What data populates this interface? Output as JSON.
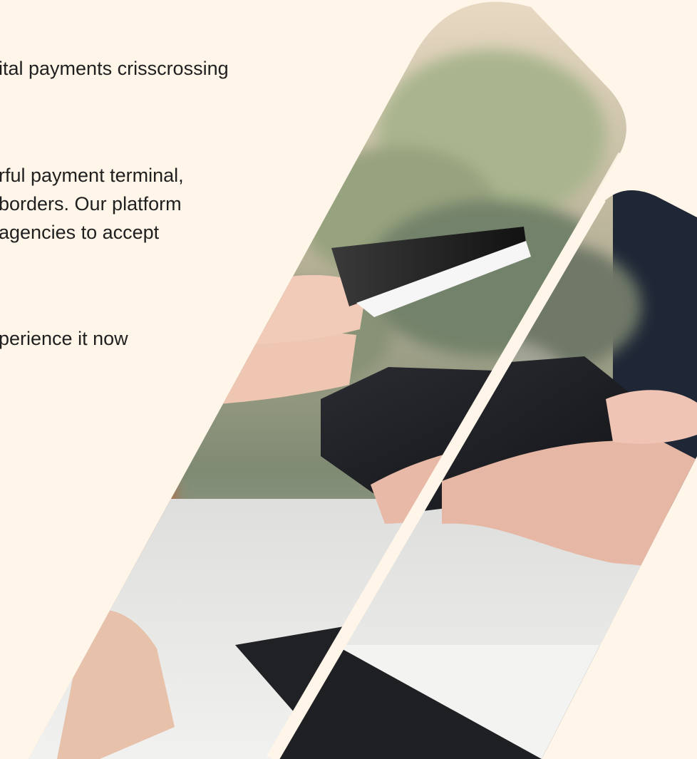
{
  "intro": {
    "line1": "ital payments crisscrossing",
    "line2": "rful payment terminal,",
    "line3": "borders. Our platform",
    "line4": "agencies to accept",
    "line5": "perience it now"
  },
  "colors": {
    "background": "#fff5e8",
    "text": "#1f1f1f"
  },
  "visual": {
    "image_icon": "payment-terminal-photo",
    "background_blur_icon": "blurred-foliage"
  }
}
